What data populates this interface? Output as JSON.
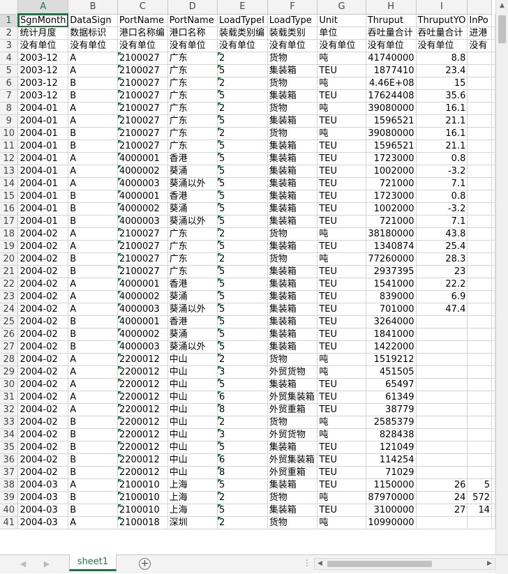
{
  "columns": [
    "A",
    "B",
    "C",
    "D",
    "E",
    "F",
    "G",
    "H",
    "I",
    ""
  ],
  "active_column": "A",
  "active_row": 1,
  "rows": [
    {
      "n": "1",
      "c": [
        "SgnMonth",
        "DataSign",
        "PortName",
        "PortName",
        "LoadTypeI",
        "LoadType",
        "Unit",
        "Thruput",
        "ThruputYO",
        "InPo"
      ]
    },
    {
      "n": "2",
      "c": [
        "统计月度",
        "数据标识",
        "港口名称编",
        "港口名称",
        "装载类别编",
        "装载类别",
        "单位",
        "吞吐量合计",
        "吞吐量合计",
        "进港"
      ]
    },
    {
      "n": "3",
      "c": [
        "没有单位",
        "没有单位",
        "没有单位",
        "没有单位",
        "没有单位",
        "没有单位",
        "没有单位",
        "没有单位",
        "没有单位",
        "没有"
      ]
    },
    {
      "n": "4",
      "c": [
        "2003-12",
        "A",
        "2100027",
        "广东",
        "2",
        "货物",
        "吨",
        "41740000",
        "8.8",
        ""
      ]
    },
    {
      "n": "5",
      "c": [
        "2003-12",
        "A",
        "2100027",
        "广东",
        "5",
        "集装箱",
        "TEU",
        "1877410",
        "23.4",
        ""
      ]
    },
    {
      "n": "6",
      "c": [
        "2003-12",
        "B",
        "2100027",
        "广东",
        "2",
        "货物",
        "吨",
        "4.46E+08",
        "15",
        ""
      ]
    },
    {
      "n": "7",
      "c": [
        "2003-12",
        "B",
        "2100027",
        "广东",
        "5",
        "集装箱",
        "TEU",
        "17624408",
        "35.6",
        ""
      ]
    },
    {
      "n": "8",
      "c": [
        "2004-01",
        "A",
        "2100027",
        "广东",
        "2",
        "货物",
        "吨",
        "39080000",
        "16.1",
        ""
      ]
    },
    {
      "n": "9",
      "c": [
        "2004-01",
        "A",
        "2100027",
        "广东",
        "5",
        "集装箱",
        "TEU",
        "1596521",
        "21.1",
        ""
      ]
    },
    {
      "n": "10",
      "c": [
        "2004-01",
        "B",
        "2100027",
        "广东",
        "2",
        "货物",
        "吨",
        "39080000",
        "16.1",
        ""
      ]
    },
    {
      "n": "11",
      "c": [
        "2004-01",
        "B",
        "2100027",
        "广东",
        "5",
        "集装箱",
        "TEU",
        "1596521",
        "21.1",
        ""
      ]
    },
    {
      "n": "12",
      "c": [
        "2004-01",
        "A",
        "4000001",
        "香港",
        "5",
        "集装箱",
        "TEU",
        "1723000",
        "0.8",
        ""
      ]
    },
    {
      "n": "13",
      "c": [
        "2004-01",
        "A",
        "4000002",
        "葵涌",
        "5",
        "集装箱",
        "TEU",
        "1002000",
        "-3.2",
        ""
      ]
    },
    {
      "n": "14",
      "c": [
        "2004-01",
        "A",
        "4000003",
        "葵涌以外",
        "5",
        "集装箱",
        "TEU",
        "721000",
        "7.1",
        ""
      ]
    },
    {
      "n": "15",
      "c": [
        "2004-01",
        "B",
        "4000001",
        "香港",
        "5",
        "集装箱",
        "TEU",
        "1723000",
        "0.8",
        ""
      ]
    },
    {
      "n": "16",
      "c": [
        "2004-01",
        "B",
        "4000002",
        "葵涌",
        "5",
        "集装箱",
        "TEU",
        "1002000",
        "-3.2",
        ""
      ]
    },
    {
      "n": "17",
      "c": [
        "2004-01",
        "B",
        "4000003",
        "葵涌以外",
        "5",
        "集装箱",
        "TEU",
        "721000",
        "7.1",
        ""
      ]
    },
    {
      "n": "18",
      "c": [
        "2004-02",
        "A",
        "2100027",
        "广东",
        "2",
        "货物",
        "吨",
        "38180000",
        "43.8",
        ""
      ]
    },
    {
      "n": "19",
      "c": [
        "2004-02",
        "A",
        "2100027",
        "广东",
        "5",
        "集装箱",
        "TEU",
        "1340874",
        "25.4",
        ""
      ]
    },
    {
      "n": "20",
      "c": [
        "2004-02",
        "B",
        "2100027",
        "广东",
        "2",
        "货物",
        "吨",
        "77260000",
        "28.3",
        ""
      ]
    },
    {
      "n": "21",
      "c": [
        "2004-02",
        "B",
        "2100027",
        "广东",
        "5",
        "集装箱",
        "TEU",
        "2937395",
        "23",
        ""
      ]
    },
    {
      "n": "22",
      "c": [
        "2004-02",
        "A",
        "4000001",
        "香港",
        "5",
        "集装箱",
        "TEU",
        "1541000",
        "22.2",
        ""
      ]
    },
    {
      "n": "23",
      "c": [
        "2004-02",
        "A",
        "4000002",
        "葵涌",
        "5",
        "集装箱",
        "TEU",
        "839000",
        "6.9",
        ""
      ]
    },
    {
      "n": "24",
      "c": [
        "2004-02",
        "A",
        "4000003",
        "葵涌以外",
        "5",
        "集装箱",
        "TEU",
        "701000",
        "47.4",
        ""
      ]
    },
    {
      "n": "25",
      "c": [
        "2004-02",
        "B",
        "4000001",
        "香港",
        "5",
        "集装箱",
        "TEU",
        "3264000",
        "",
        ""
      ]
    },
    {
      "n": "26",
      "c": [
        "2004-02",
        "B",
        "4000002",
        "葵涌",
        "5",
        "集装箱",
        "TEU",
        "1841000",
        "",
        ""
      ]
    },
    {
      "n": "27",
      "c": [
        "2004-02",
        "B",
        "4000003",
        "葵涌以外",
        "5",
        "集装箱",
        "TEU",
        "1422000",
        "",
        ""
      ]
    },
    {
      "n": "28",
      "c": [
        "2004-02",
        "A",
        "2200012",
        "中山",
        "2",
        "货物",
        "吨",
        "1519212",
        "",
        ""
      ]
    },
    {
      "n": "29",
      "c": [
        "2004-02",
        "A",
        "2200012",
        "中山",
        "3",
        "外贸货物",
        "吨",
        "451505",
        "",
        ""
      ]
    },
    {
      "n": "30",
      "c": [
        "2004-02",
        "A",
        "2200012",
        "中山",
        "5",
        "集装箱",
        "TEU",
        "65497",
        "",
        ""
      ]
    },
    {
      "n": "31",
      "c": [
        "2004-02",
        "A",
        "2200012",
        "中山",
        "6",
        "外贸集装箱",
        "TEU",
        "61349",
        "",
        ""
      ]
    },
    {
      "n": "32",
      "c": [
        "2004-02",
        "A",
        "2200012",
        "中山",
        "8",
        "外贸重箱",
        "TEU",
        "38779",
        "",
        ""
      ]
    },
    {
      "n": "33",
      "c": [
        "2004-02",
        "B",
        "2200012",
        "中山",
        "2",
        "货物",
        "吨",
        "2585379",
        "",
        ""
      ]
    },
    {
      "n": "34",
      "c": [
        "2004-02",
        "B",
        "2200012",
        "中山",
        "3",
        "外贸货物",
        "吨",
        "828438",
        "",
        ""
      ]
    },
    {
      "n": "35",
      "c": [
        "2004-02",
        "B",
        "2200012",
        "中山",
        "5",
        "集装箱",
        "TEU",
        "121049",
        "",
        ""
      ]
    },
    {
      "n": "36",
      "c": [
        "2004-02",
        "B",
        "2200012",
        "中山",
        "6",
        "外贸集装箱",
        "TEU",
        "114254",
        "",
        ""
      ]
    },
    {
      "n": "37",
      "c": [
        "2004-02",
        "B",
        "2200012",
        "中山",
        "8",
        "外贸重箱",
        "TEU",
        "71029",
        "",
        ""
      ]
    },
    {
      "n": "38",
      "c": [
        "2004-03",
        "A",
        "2100010",
        "上海",
        "5",
        "集装箱",
        "TEU",
        "1150000",
        "26",
        "5"
      ]
    },
    {
      "n": "39",
      "c": [
        "2004-03",
        "B",
        "2100010",
        "上海",
        "2",
        "货物",
        "吨",
        "87970000",
        "24",
        "572"
      ]
    },
    {
      "n": "40",
      "c": [
        "2004-03",
        "B",
        "2100010",
        "上海",
        "5",
        "集装箱",
        "TEU",
        "3100000",
        "27",
        "14"
      ]
    },
    {
      "n": "41",
      "c": [
        "2004-03",
        "A",
        "2100018",
        "深圳",
        "2",
        "货物",
        "吨",
        "10990000",
        "",
        ""
      ]
    }
  ],
  "sheet_tab": {
    "label": "sheet1"
  },
  "icons": {
    "nav_prev": "triangle-left-icon",
    "nav_next": "triangle-right-icon",
    "add_sheet": "plus-circle-icon",
    "scroll_up": "triangle-up-icon",
    "scroll_left": "triangle-left-icon",
    "scroll_right": "triangle-right-icon"
  },
  "accent_color": "#217346"
}
